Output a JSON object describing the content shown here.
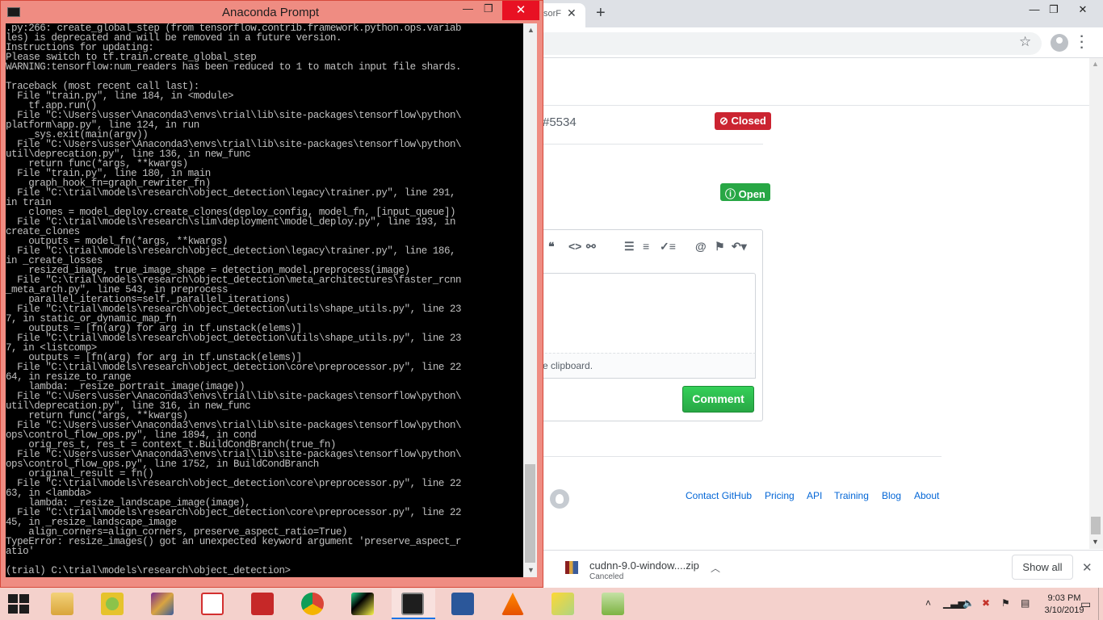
{
  "browser": {
    "tab_title": "sorF",
    "tab_close": "✕",
    "new_tab": "+",
    "window_minimize": "—",
    "window_maximize": "❐",
    "window_close": "✕",
    "issue_ref": "#5534",
    "closed_badge": "Closed",
    "open_badge": "Open",
    "clipboard_text": "e clipboard.",
    "comment_button": "Comment",
    "footer_links": [
      "Contact GitHub",
      "Pricing",
      "API",
      "Training",
      "Blog",
      "About"
    ],
    "toolbar_icons": [
      "quote-icon",
      "code-icon",
      "link-icon",
      "unordered-list-icon",
      "ordered-list-icon",
      "task-list-icon",
      "mention-icon",
      "bookmark-icon",
      "reply-icon"
    ]
  },
  "downloads": {
    "file_name": "cudnn-9.0-window....zip",
    "status": "Canceled",
    "show_all": "Show all",
    "close": "✕"
  },
  "prompt": {
    "title": "Anaconda Prompt",
    "minimize": "—",
    "maximize": "❐",
    "close": "✕",
    "console_lines": [
      ".py:266: create_global_step (from tensorflow.contrib.framework.python.ops.variab",
      "les) is deprecated and will be removed in a future version.",
      "Instructions for updating:",
      "Please switch to tf.train.create_global_step",
      "WARNING:tensorflow:num_readers has been reduced to 1 to match input file shards.",
      "",
      "Traceback (most recent call last):",
      "  File \"train.py\", line 184, in <module>",
      "    tf.app.run()",
      "  File \"C:\\Users\\usser\\Anaconda3\\envs\\trial\\lib\\site-packages\\tensorflow\\python\\",
      "platform\\app.py\", line 124, in run",
      "    _sys.exit(main(argv))",
      "  File \"C:\\Users\\usser\\Anaconda3\\envs\\trial\\lib\\site-packages\\tensorflow\\python\\",
      "util\\deprecation.py\", line 136, in new_func",
      "    return func(*args, **kwargs)",
      "  File \"train.py\", line 180, in main",
      "    graph_hook_fn=graph_rewriter_fn)",
      "  File \"C:\\trial\\models\\research\\object_detection\\legacy\\trainer.py\", line 291,",
      "in train",
      "    clones = model_deploy.create_clones(deploy_config, model_fn, [input_queue])",
      "  File \"C:\\trial\\models\\research\\slim\\deployment\\model_deploy.py\", line 193, in",
      "create_clones",
      "    outputs = model_fn(*args, **kwargs)",
      "  File \"C:\\trial\\models\\research\\object_detection\\legacy\\trainer.py\", line 186,",
      "in _create_losses",
      "    resized_image, true_image_shape = detection_model.preprocess(image)",
      "  File \"C:\\trial\\models\\research\\object_detection\\meta_architectures\\faster_rcnn",
      "_meta_arch.py\", line 543, in preprocess",
      "    parallel_iterations=self._parallel_iterations)",
      "  File \"C:\\trial\\models\\research\\object_detection\\utils\\shape_utils.py\", line 23",
      "7, in static_or_dynamic_map_fn",
      "    outputs = [fn(arg) for arg in tf.unstack(elems)]",
      "  File \"C:\\trial\\models\\research\\object_detection\\utils\\shape_utils.py\", line 23",
      "7, in <listcomp>",
      "    outputs = [fn(arg) for arg in tf.unstack(elems)]",
      "  File \"C:\\trial\\models\\research\\object_detection\\core\\preprocessor.py\", line 22",
      "64, in resize_to_range",
      "    lambda: _resize_portrait_image(image))",
      "  File \"C:\\Users\\usser\\Anaconda3\\envs\\trial\\lib\\site-packages\\tensorflow\\python\\",
      "util\\deprecation.py\", line 316, in new_func",
      "    return func(*args, **kwargs)",
      "  File \"C:\\Users\\usser\\Anaconda3\\envs\\trial\\lib\\site-packages\\tensorflow\\python\\",
      "ops\\control_flow_ops.py\", line 1894, in cond",
      "    orig_res_t, res_t = context_t.BuildCondBranch(true_fn)",
      "  File \"C:\\Users\\usser\\Anaconda3\\envs\\trial\\lib\\site-packages\\tensorflow\\python\\",
      "ops\\control_flow_ops.py\", line 1752, in BuildCondBranch",
      "    original_result = fn()",
      "  File \"C:\\trial\\models\\research\\object_detection\\core\\preprocessor.py\", line 22",
      "63, in <lambda>",
      "    lambda: _resize_landscape_image(image),",
      "  File \"C:\\trial\\models\\research\\object_detection\\core\\preprocessor.py\", line 22",
      "45, in _resize_landscape_image",
      "    align_corners=align_corners, preserve_aspect_ratio=True)",
      "TypeError: resize_images() got an unexpected keyword argument 'preserve_aspect_r",
      "atio'",
      "",
      "(trial) C:\\trial\\models\\research\\object_detection>"
    ]
  },
  "taskbar": {
    "apps": [
      "file-explorer",
      "qgis",
      "winrar",
      "10-app",
      "pdf-reader",
      "chrome",
      "pycharm",
      "command-prompt",
      "word",
      "vlc",
      "photos",
      "notepad-plus-plus"
    ],
    "time": "9:03 PM",
    "date": "3/10/2019"
  }
}
